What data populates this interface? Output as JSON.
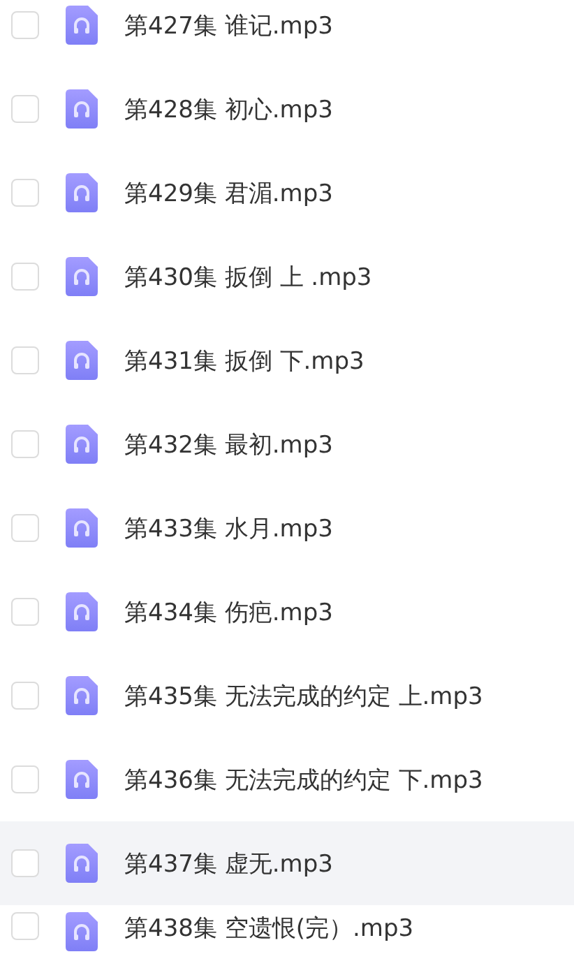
{
  "files": [
    {
      "name": "第427集 谁记.mp3",
      "checked": false,
      "highlighted": false
    },
    {
      "name": "第428集 初心.mp3",
      "checked": false,
      "highlighted": false
    },
    {
      "name": "第429集 君湄.mp3",
      "checked": false,
      "highlighted": false
    },
    {
      "name": "第430集 扳倒 上 .mp3",
      "checked": false,
      "highlighted": false
    },
    {
      "name": "第431集 扳倒 下.mp3",
      "checked": false,
      "highlighted": false
    },
    {
      "name": "第432集 最初.mp3",
      "checked": false,
      "highlighted": false
    },
    {
      "name": "第433集 水月.mp3",
      "checked": false,
      "highlighted": false
    },
    {
      "name": "第434集 伤疤.mp3",
      "checked": false,
      "highlighted": false
    },
    {
      "name": "第435集 无法完成的约定 上.mp3",
      "checked": false,
      "highlighted": false
    },
    {
      "name": "第436集 无法完成的约定 下.mp3",
      "checked": false,
      "highlighted": false
    },
    {
      "name": "第437集 虚无.mp3",
      "checked": false,
      "highlighted": true
    },
    {
      "name": "第438集 空遗恨(完）.mp3",
      "checked": false,
      "highlighted": false
    }
  ]
}
